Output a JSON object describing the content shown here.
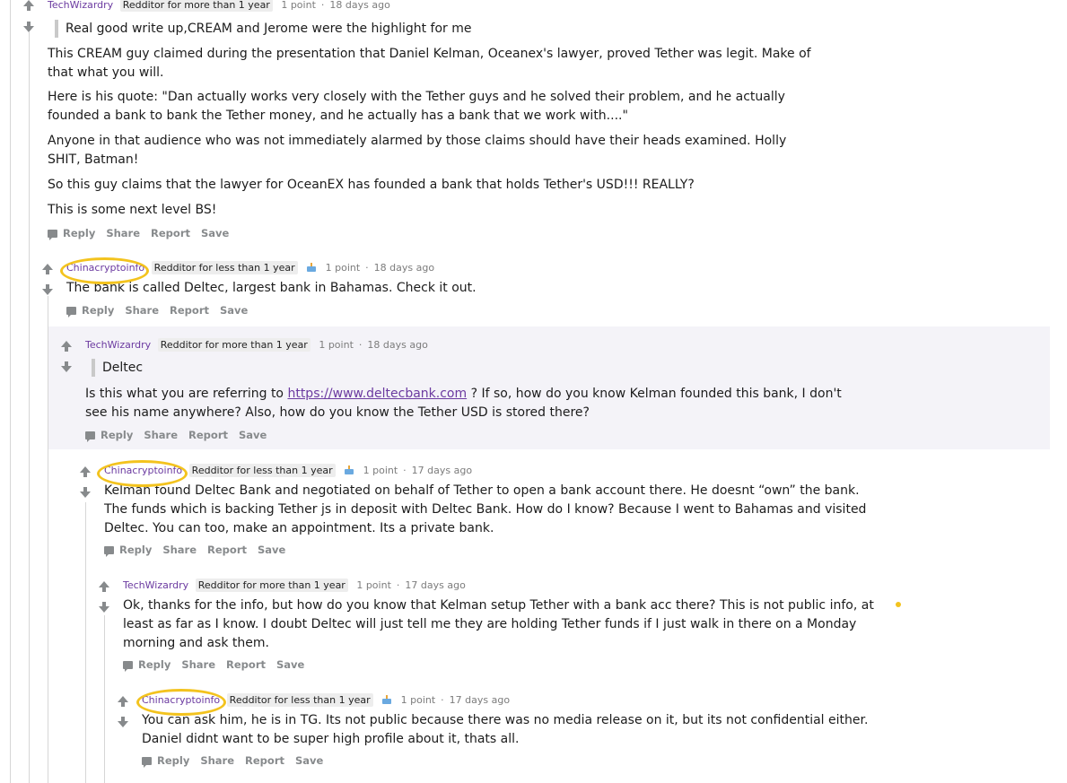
{
  "comments": [
    {
      "user": "TechWizardry",
      "flair": "Redditor for more than 1 year",
      "cake": false,
      "points": "1 point",
      "time": "18 days ago",
      "quote": "Real good write up,CREAM and Jerome were the highlight for me",
      "paragraphs": [
        [
          "This CREAM guy claimed during the presentation that Daniel Kelman, Oceanex's lawyer, proved Tether was legit. Make of",
          "that what you will."
        ],
        [
          "Here is his quote: \"Dan actually works very closely with the Tether guys and he solved their problem, and he actually",
          "founded a bank to bank the Tether money, and he actually has a bank that we work with....\""
        ],
        [
          "Anyone in that audience who was not immediately alarmed by those claims should have their heads examined. Holly",
          "SHIT, Batman!"
        ],
        [
          "So this guy claims that the lawyer for OceanEX has founded a bank that holds Tether's USD!!! REALLY?"
        ],
        [
          "This is some next level BS!"
        ]
      ]
    },
    {
      "user": "Chinacryptoinfo",
      "flair": "Redditor for less than 1 year",
      "cake": true,
      "points": "1 point",
      "time": "18 days ago",
      "paragraphs": [
        [
          "The bank is called Deltec, largest bank in Bahamas. Check it out."
        ]
      ]
    },
    {
      "user": "TechWizardry",
      "flair": "Redditor for more than 1 year",
      "cake": false,
      "points": "1 point",
      "time": "18 days ago",
      "quote": "Deltec",
      "paragraphs": [
        [
          "Is this what you are referring to ",
          "https://www.deltecbank.com",
          " ? If so, how do you know Kelman founded this bank, I don't",
          "see his name anywhere? Also, how do you know the Tether USD is stored there?"
        ]
      ]
    },
    {
      "user": "Chinacryptoinfo",
      "flair": "Redditor for less than 1 year",
      "cake": true,
      "points": "1 point",
      "time": "17 days ago",
      "paragraphs": [
        [
          "Kelman found Deltec Bank and negotiated on behalf of Tether to open a bank account there. He doesnt “own” the bank.",
          "The funds which is backing Tether js in deposit with Deltec Bank. How do I know? Because I went to Bahamas and visited",
          "Deltec. You can too, make an appointment. Its a private bank."
        ]
      ]
    },
    {
      "user": "TechWizardry",
      "flair": "Redditor for more than 1 year",
      "cake": false,
      "points": "1 point",
      "time": "17 days ago",
      "paragraphs": [
        [
          "Ok, thanks for the info, but how do you know that Kelman setup Tether with a bank acc there? This is not public info, at",
          "least as far as I know. I doubt Deltec will just tell me they are holding Tether funds if I just walk in there on a Monday",
          "morning and ask them."
        ]
      ]
    },
    {
      "user": "Chinacryptoinfo",
      "flair": "Redditor for less than 1 year",
      "cake": true,
      "points": "1 point",
      "time": "17 days ago",
      "paragraphs": [
        [
          "You can ask him, he is in TG. Its not public because there was no media release on it, but its not confidential either.",
          "Daniel didnt want to be super high profile about it, thats all."
        ]
      ]
    }
  ],
  "actions": [
    "Reply",
    "Share",
    "Report",
    "Save"
  ],
  "annotation_color": "#f3c31e"
}
